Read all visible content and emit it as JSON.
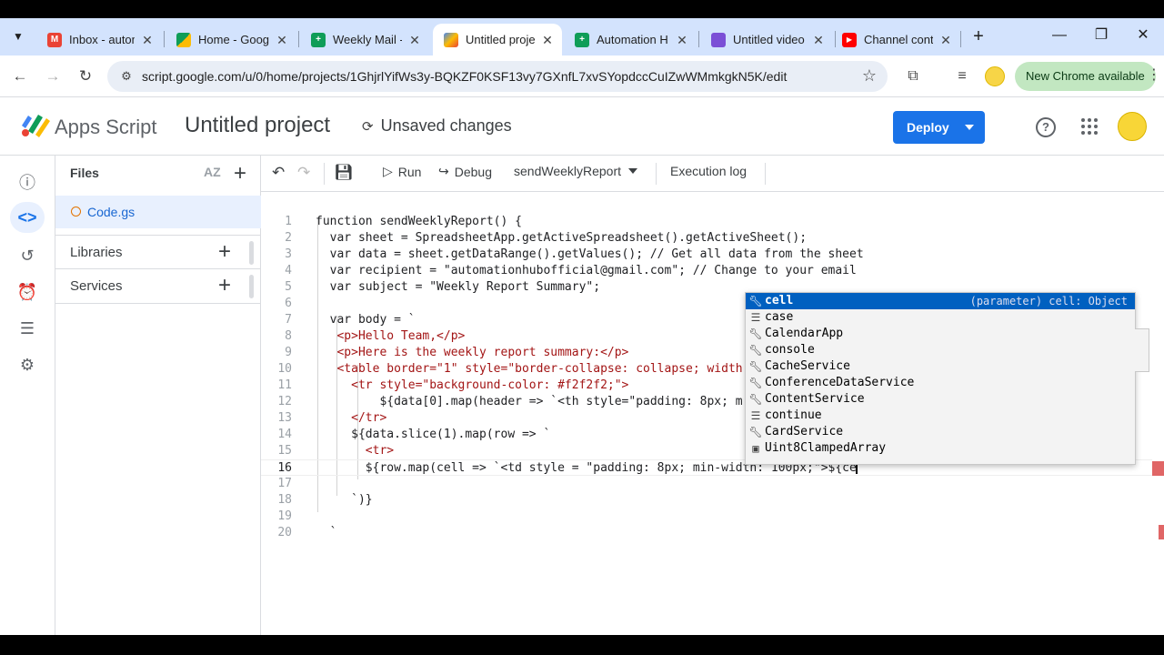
{
  "browser": {
    "tabs": [
      {
        "title": "Inbox - autom",
        "color": "#ea4335",
        "glyph": "M"
      },
      {
        "title": "Home - Goog",
        "color": "#34a853",
        "glyph": "▲"
      },
      {
        "title": "Weekly Mail -",
        "color": "#0f9d58",
        "glyph": "+"
      },
      {
        "title": "Untitled proje",
        "color": "#4285f4",
        "glyph": "✦"
      },
      {
        "title": "Automation H",
        "color": "#0f9d58",
        "glyph": "+"
      },
      {
        "title": "Untitled video",
        "color": "#7b4fd6",
        "glyph": "▬"
      },
      {
        "title": "Channel cont",
        "color": "#ff0000",
        "glyph": "▶"
      }
    ],
    "url": "script.google.com/u/0/home/projects/1GhjrlYifWs3y-BQKZF0KSF13vy7GXnfL7xvSYopdccCuIZwWMmkgkN5K/edit",
    "chrome_available": "New Chrome available"
  },
  "header": {
    "app_name": "Apps Script",
    "project_title": "Untitled project",
    "unsaved": "Unsaved changes",
    "deploy": "Deploy"
  },
  "files_panel": {
    "title": "Files",
    "file": "Code.gs",
    "libraries": "Libraries",
    "services": "Services"
  },
  "editor_toolbar": {
    "run": "Run",
    "debug": "Debug",
    "function": "sendWeeklyReport",
    "execution_log": "Execution log"
  },
  "suggestions": [
    {
      "label": "cell",
      "detail": "(parameter) cell: Object",
      "icon": "wrench"
    },
    {
      "label": "case",
      "detail": "",
      "icon": "keyword"
    },
    {
      "label": "CalendarApp",
      "detail": "",
      "icon": "wrench"
    },
    {
      "label": "console",
      "detail": "",
      "icon": "wrench"
    },
    {
      "label": "CacheService",
      "detail": "",
      "icon": "wrench"
    },
    {
      "label": "ConferenceDataService",
      "detail": "",
      "icon": "wrench"
    },
    {
      "label": "ContentService",
      "detail": "",
      "icon": "wrench"
    },
    {
      "label": "continue",
      "detail": "",
      "icon": "keyword"
    },
    {
      "label": "CardService",
      "detail": "",
      "icon": "wrench"
    },
    {
      "label": "Uint8ClampedArray",
      "detail": "",
      "icon": "class"
    }
  ],
  "code_lines": [
    "function sendWeeklyReport() {",
    "  var sheet = SpreadsheetApp.getActiveSpreadsheet().getActiveSheet();",
    "  var data = sheet.getDataRange().getValues(); // Get all data from the sheet",
    "  var recipient = \"automationhubofficial@gmail.com\"; // Change to your email",
    "  var subject = \"Weekly Report Summary\";",
    "",
    "  var body = `",
    "   <p>Hello Team,</p>",
    "   <p>Here is the weekly report summary:</p>",
    "   <table border=\"1\" style=\"border-collapse: collapse; width",
    "     <tr style=\"background-color: #f2f2f2;\">",
    "         ${data[0].map(header => `<th style=\"padding: 8px; m",
    "     </tr>",
    "     ${data.slice(1).map(row => `",
    "       <tr>",
    "       ${row.map(cell => `<td style = \"padding: 8px; min-width: 100px;\">${ce",
    "",
    "     `)}",
    "",
    "  `"
  ]
}
